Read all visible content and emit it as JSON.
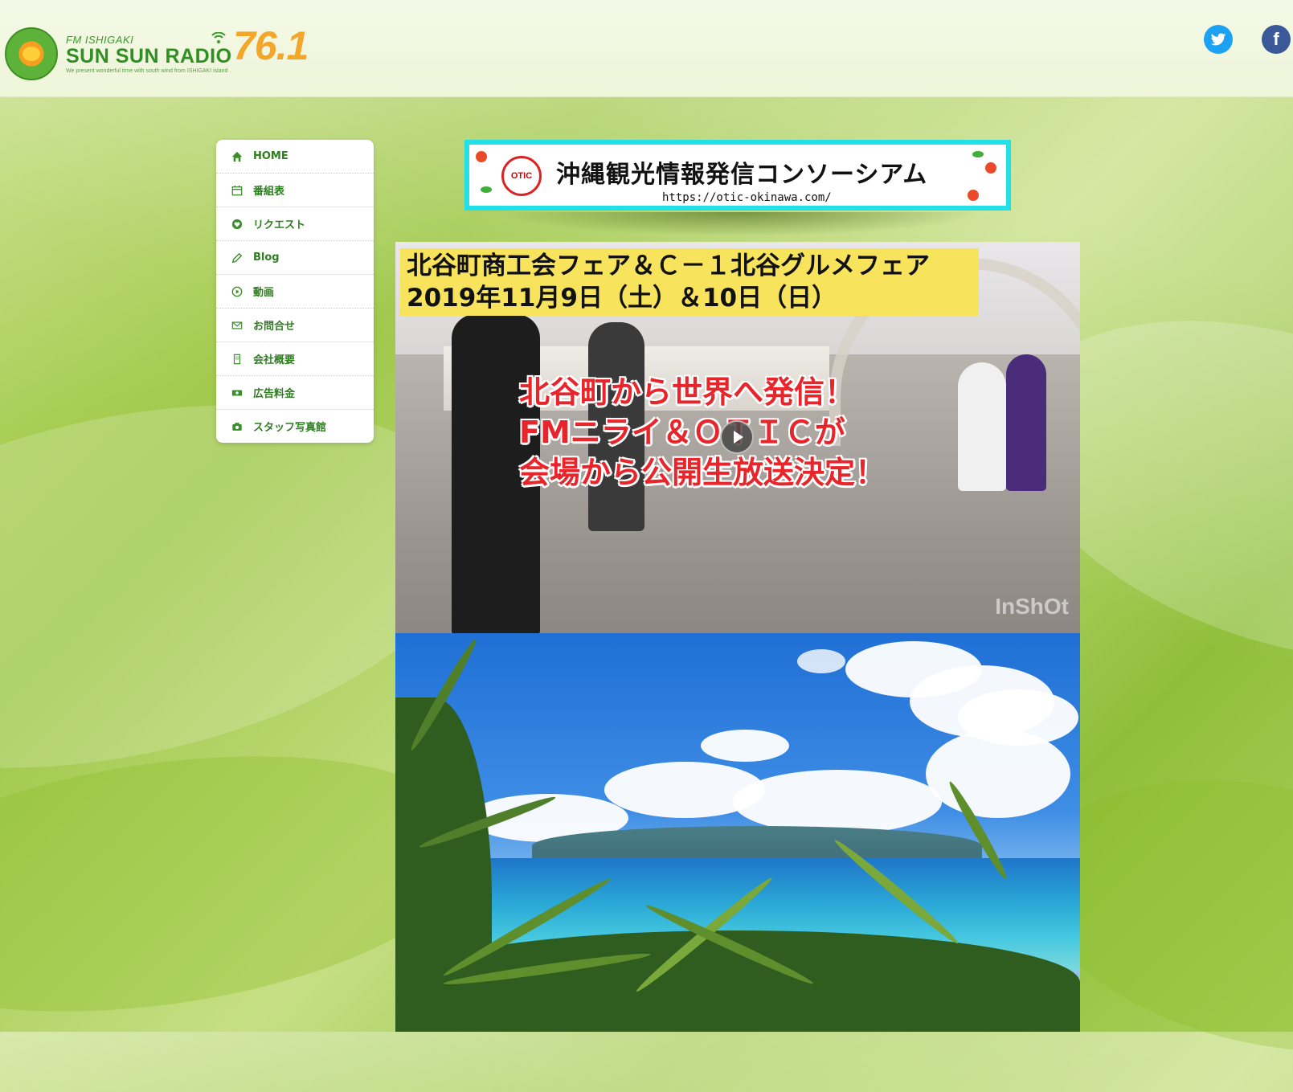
{
  "header": {
    "logo_small": "FM ISHIGAKI",
    "logo_big": "SUN SUN RADIO",
    "frequency": "76.1",
    "tagline": "We present wonderful time with south wind from ISHIGAKI island ."
  },
  "social": {
    "twitter_icon": "twitter-icon",
    "facebook_icon": "facebook-icon"
  },
  "nav": {
    "items": [
      {
        "label": "HOME",
        "icon": "home-icon"
      },
      {
        "label": "番組表",
        "icon": "calendar-icon"
      },
      {
        "label": "リクエスト",
        "icon": "heart-icon"
      },
      {
        "label": "Blog",
        "icon": "pencil-icon"
      },
      {
        "label": "動画",
        "icon": "play-circle-icon"
      },
      {
        "label": "お問合せ",
        "icon": "mail-icon"
      },
      {
        "label": "会社概要",
        "icon": "building-icon"
      },
      {
        "label": "広告料金",
        "icon": "money-icon"
      },
      {
        "label": "スタッフ写真館",
        "icon": "camera-icon"
      }
    ]
  },
  "banner": {
    "badge": "OTIC",
    "title": "沖縄観光情報発信コンソーシアム",
    "url": "https://otic-okinawa.com/"
  },
  "video": {
    "caption_line1": "北谷町商工会フェア＆Ｃ－１北谷グルメフェア",
    "caption_line2": "2019年11月9日（土）＆10日（日）",
    "red_line1": "北谷町から世界へ発信！",
    "red_line2": "FMニライ＆ＯＴＩＣが",
    "red_line3": "会場から公開生放送決定！",
    "watermark": "InShOt"
  },
  "colors": {
    "accent_green": "#2e7d20",
    "banner_border": "#22e0e8",
    "caption_bg": "#f7e45c",
    "caption_red": "#e7252a",
    "frequency": "#f3a62a"
  }
}
